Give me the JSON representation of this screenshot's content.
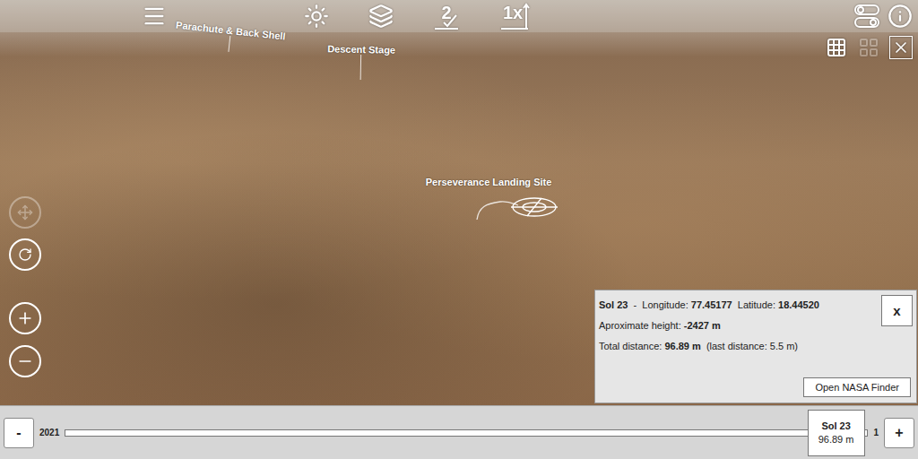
{
  "top_bar": {
    "route_count": "2",
    "height_scale": "1x"
  },
  "map": {
    "labels": [
      {
        "text": "Parachute & Back Shell",
        "kind": "pin"
      },
      {
        "text": "Descent Stage",
        "kind": "pin"
      },
      {
        "text": "Perseverance Landing Site",
        "kind": "site"
      }
    ]
  },
  "view_controls": {
    "compass_disabled": true
  },
  "right_tools": [
    {
      "disabled": false
    },
    {
      "disabled": true
    },
    {
      "disabled": false
    }
  ],
  "info_panel": {
    "sol": "Sol 23",
    "separator": "-",
    "longitude_label": "Longitude:",
    "longitude": "77.45177",
    "latitude_label": "Latitude:",
    "latitude": "18.44520",
    "height_label": "Aproximate height:",
    "height": "-2427 m",
    "distance_label": "Total distance:",
    "distance": "96.89 m",
    "last_distance": "(last distance: 5.5 m)",
    "close": "x",
    "button": "Open NASA Finder"
  },
  "timeline": {
    "minus": "-",
    "plus": "+",
    "start_label": "2021",
    "end_label": "1",
    "level": 0.96,
    "thumb_title": "Sol 23",
    "thumb_value": "96.89 m"
  }
}
